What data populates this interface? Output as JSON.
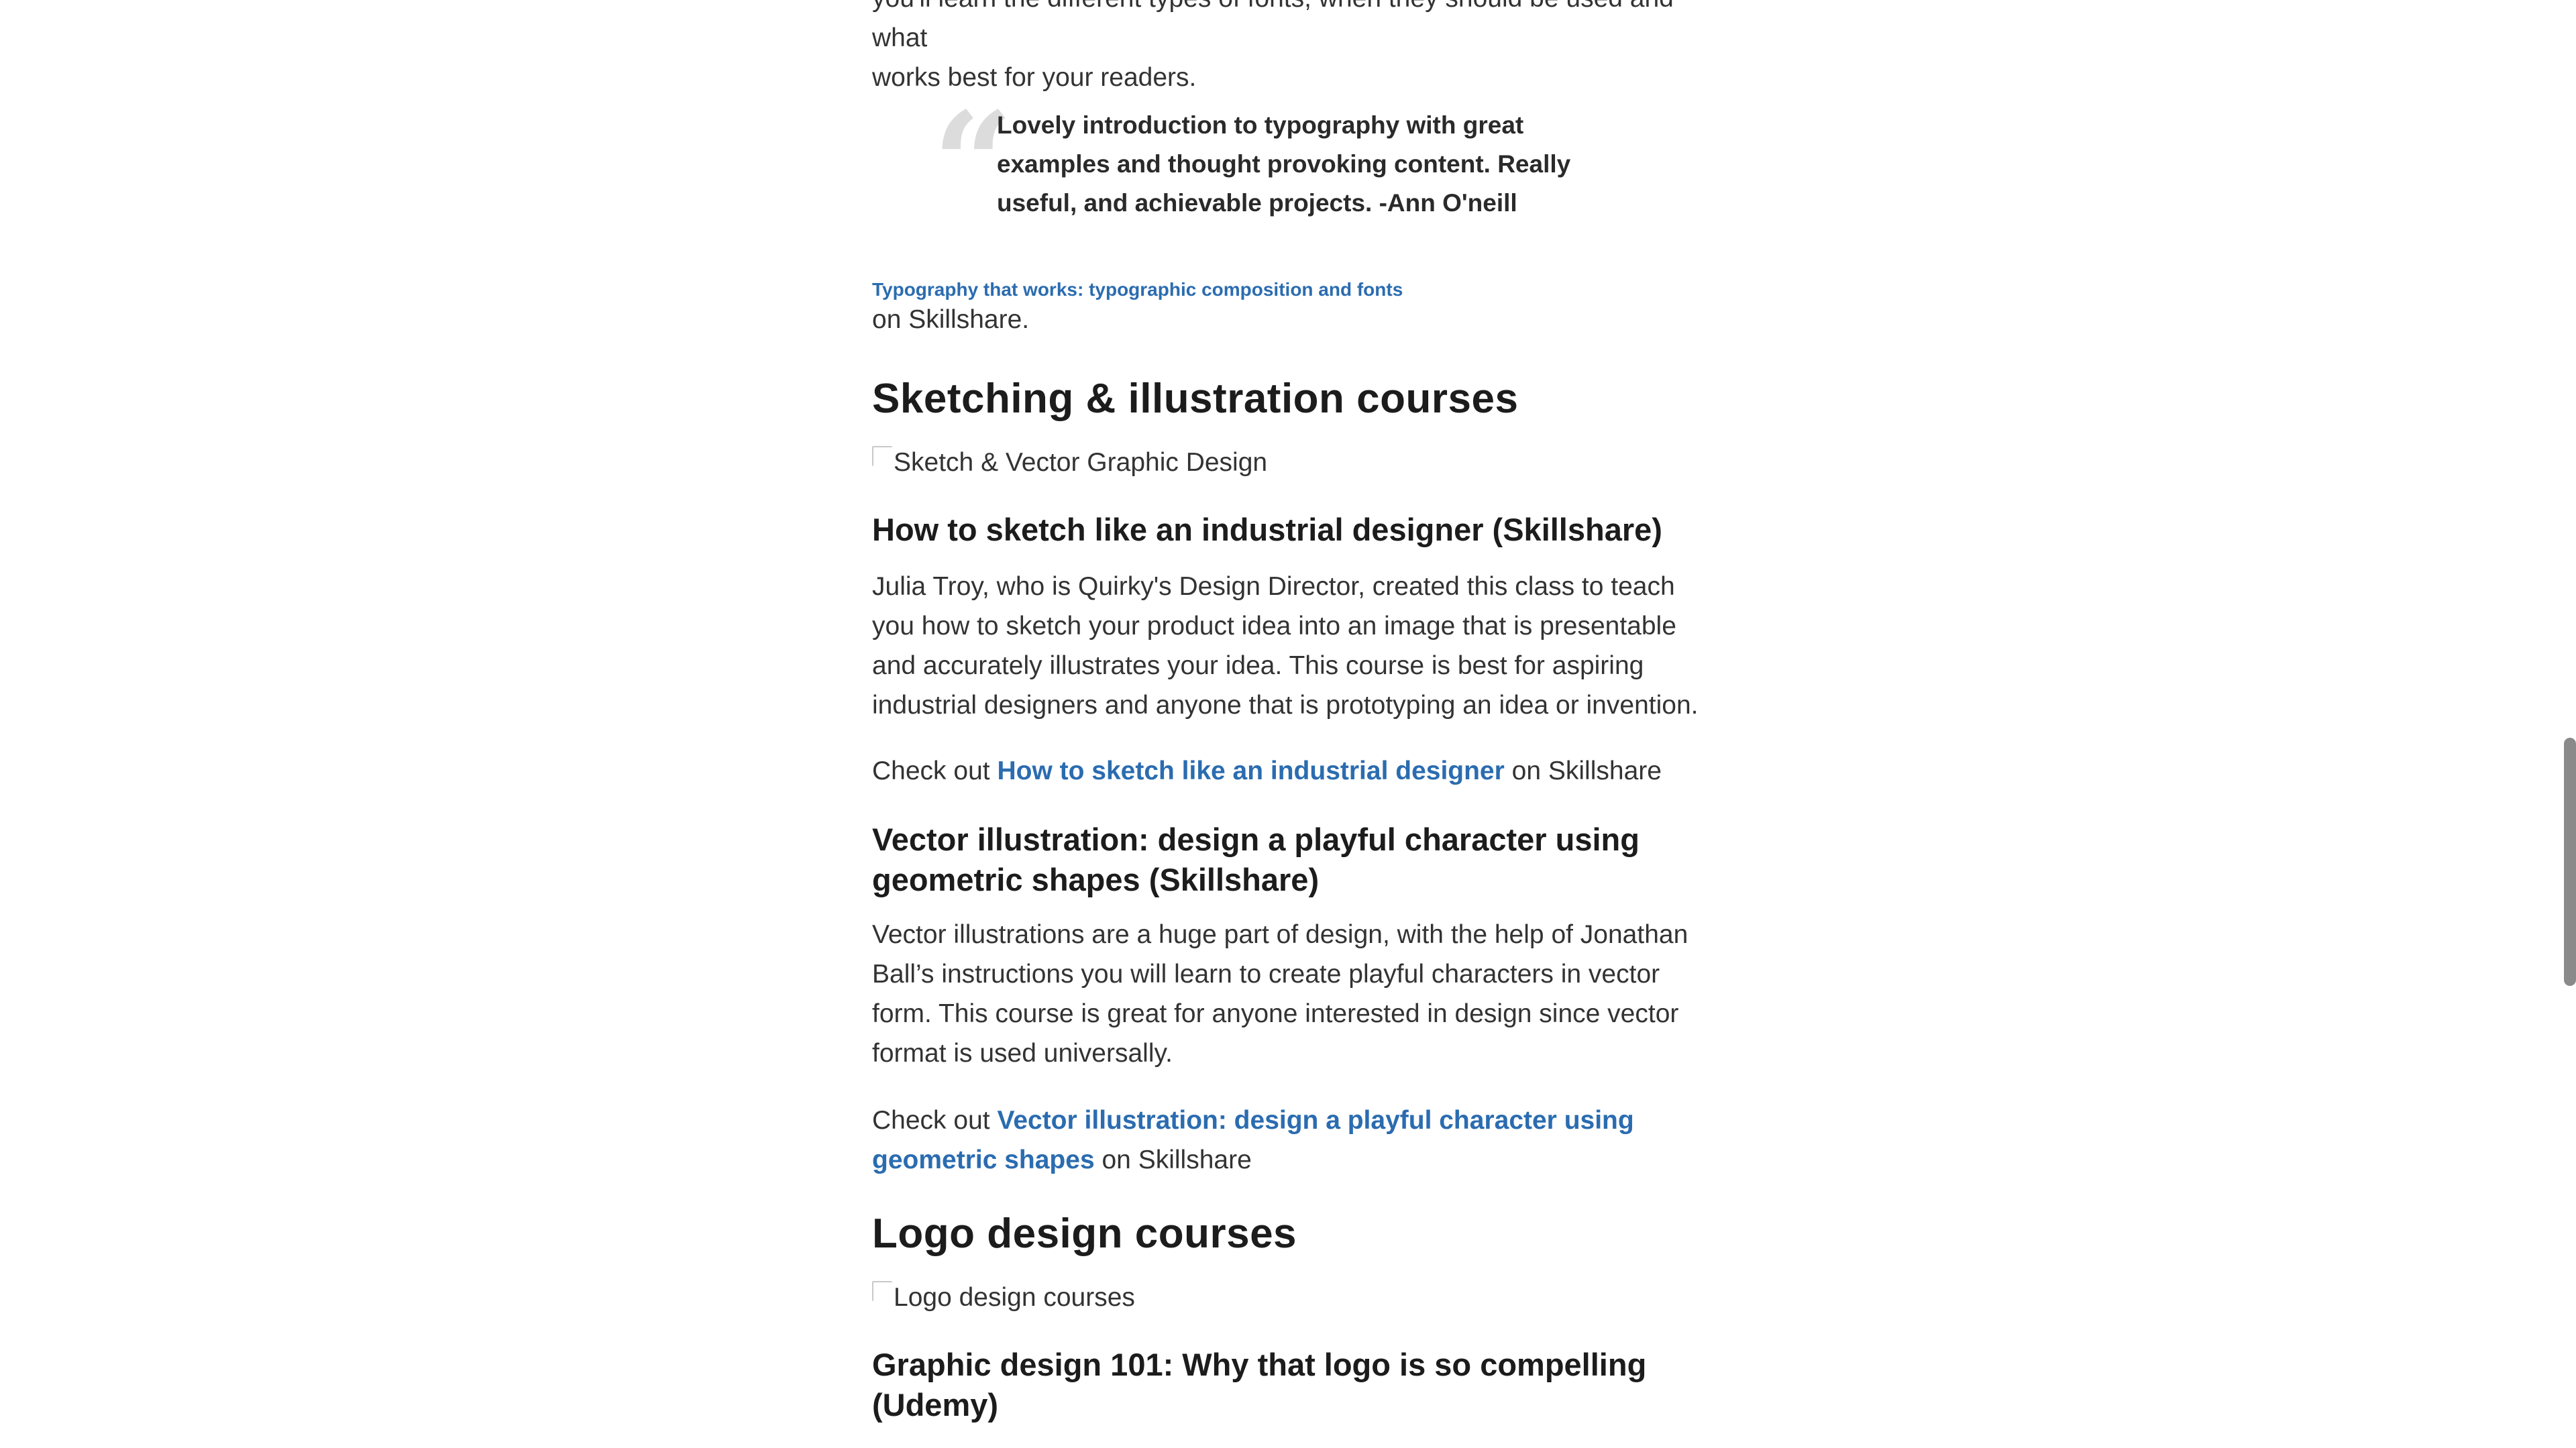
{
  "intro_partial": {
    "line1": "you'll learn the different types of fonts, when they should be used and what",
    "line2": "works best for your readers."
  },
  "testimonial": {
    "quote_glyph": "“",
    "text": "Lovely introduction to typography with great examples and thought provoking content. Really useful, and achievable projects. -Ann O'neill"
  },
  "typography_link": {
    "title": "Typography that works: typographic composition and fonts",
    "suffix": "on Skillshare."
  },
  "sections": {
    "sketching": {
      "heading": "Sketching & illustration courses",
      "image_alt": "Sketch & Vector Graphic Design",
      "course1": {
        "title": "How to sketch like an industrial designer (Skillshare)",
        "description": "Julia Troy, who is Quirky's Design Director, created this class to teach you how to sketch your product idea into an image that is presentable and accurately illustrates your idea. This course is best for aspiring industrial designers and anyone that is prototyping an idea or invention.",
        "check_prefix": "Check out",
        "link_text": "How to sketch like an industrial designer",
        "check_suffix": "on Skillshare"
      },
      "course2": {
        "title": "Vector illustration: design a playful character using geometric shapes (Skillshare)",
        "description": "Vector illustrations are a huge part of design, with the help of Jonathan Ball’s instructions you will learn to create playful characters in vector form. This course is great for anyone interested in design since vector format is used universally.",
        "check_prefix": "Check out",
        "link_text": "Vector illustration: design a playful character using geometric shapes",
        "check_suffix": "on Skillshare"
      }
    },
    "logo": {
      "heading": "Logo design courses",
      "image_alt": "Logo design courses",
      "course1": {
        "title": "Graphic design 101: Why that logo is so compelling (Udemy)"
      }
    }
  }
}
